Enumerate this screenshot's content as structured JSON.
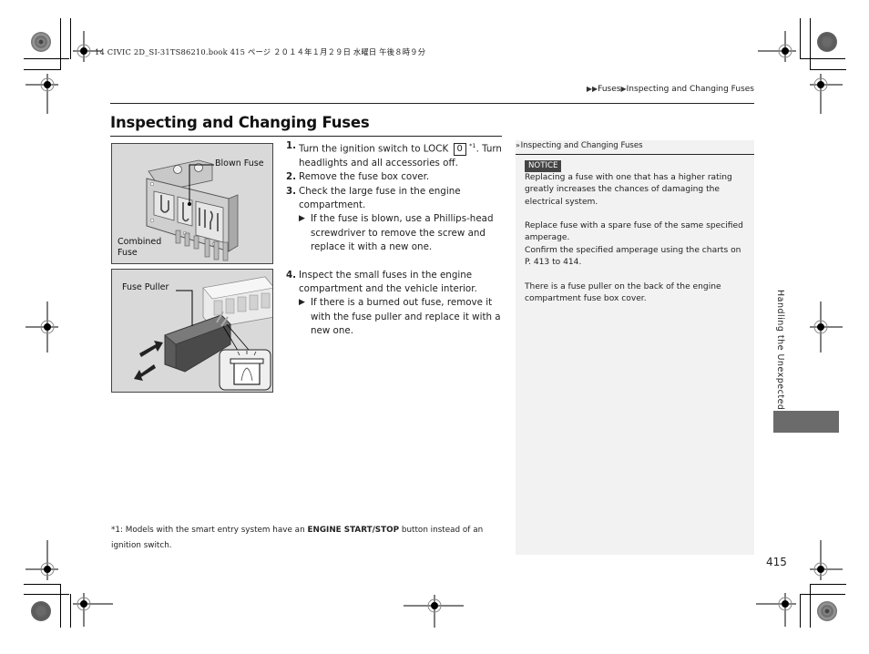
{
  "print_slug": "14 CIVIC 2D_SI-31TS86210.book  415 ページ  ２０１４年１月２９日  水曜日  午後８時９分",
  "breadcrumb": {
    "icon": "double-triangle-icon",
    "items": [
      "Fuses",
      "Inspecting and Changing Fuses"
    ]
  },
  "page": {
    "title": "Inspecting and Changing Fuses",
    "number": "415",
    "side_tab": "Handling the Unexpected"
  },
  "figures": [
    {
      "name": "combined-fuse-figure",
      "labels": {
        "blown": "Blown Fuse",
        "combined": "Combined Fuse"
      }
    },
    {
      "name": "fuse-puller-figure",
      "labels": {
        "puller": "Fuse Puller"
      }
    }
  ],
  "steps": [
    {
      "num": "1.",
      "text_before": "Turn the ignition switch to LOCK",
      "lock_symbol": "0",
      "footnote_ref": "*1",
      "text_after": ". Turn headlights and all accessories off."
    },
    {
      "num": "2.",
      "text": "Remove the fuse box cover."
    },
    {
      "num": "3.",
      "text": "Check the large fuse in the engine compartment.",
      "sub": "If the fuse is blown, use a Phillips-head screwdriver to remove the screw and replace it with a new one."
    },
    {
      "num": "4.",
      "text": "Inspect the small fuses in the engine compartment and the vehicle interior.",
      "sub": "If there is a burned out fuse, remove it with the fuse puller and replace it with a new one."
    }
  ],
  "footnote": {
    "prefix": "*1: Models with the smart entry system have an ",
    "bold": "ENGINE START/STOP",
    "suffix": " button instead of an ignition switch."
  },
  "sidebar": {
    "heading": "Inspecting and Changing Fuses",
    "notice_label": "NOTICE",
    "paragraphs": [
      "Replacing a fuse with one that has a higher rating greatly increases the chances of damaging the electrical system.",
      "Replace fuse with a spare fuse of the same specified amperage.\nConfirm the specified amperage using the charts on P. 413 to 414.",
      "There is a fuse puller on the back of the engine compartment fuse box cover."
    ]
  },
  "colors": {
    "sidebar_bg": "#f2f2f2",
    "notice_bg": "#444444",
    "tab_block": "#6b6b6b",
    "figure_bg": "#d9d9d9"
  }
}
